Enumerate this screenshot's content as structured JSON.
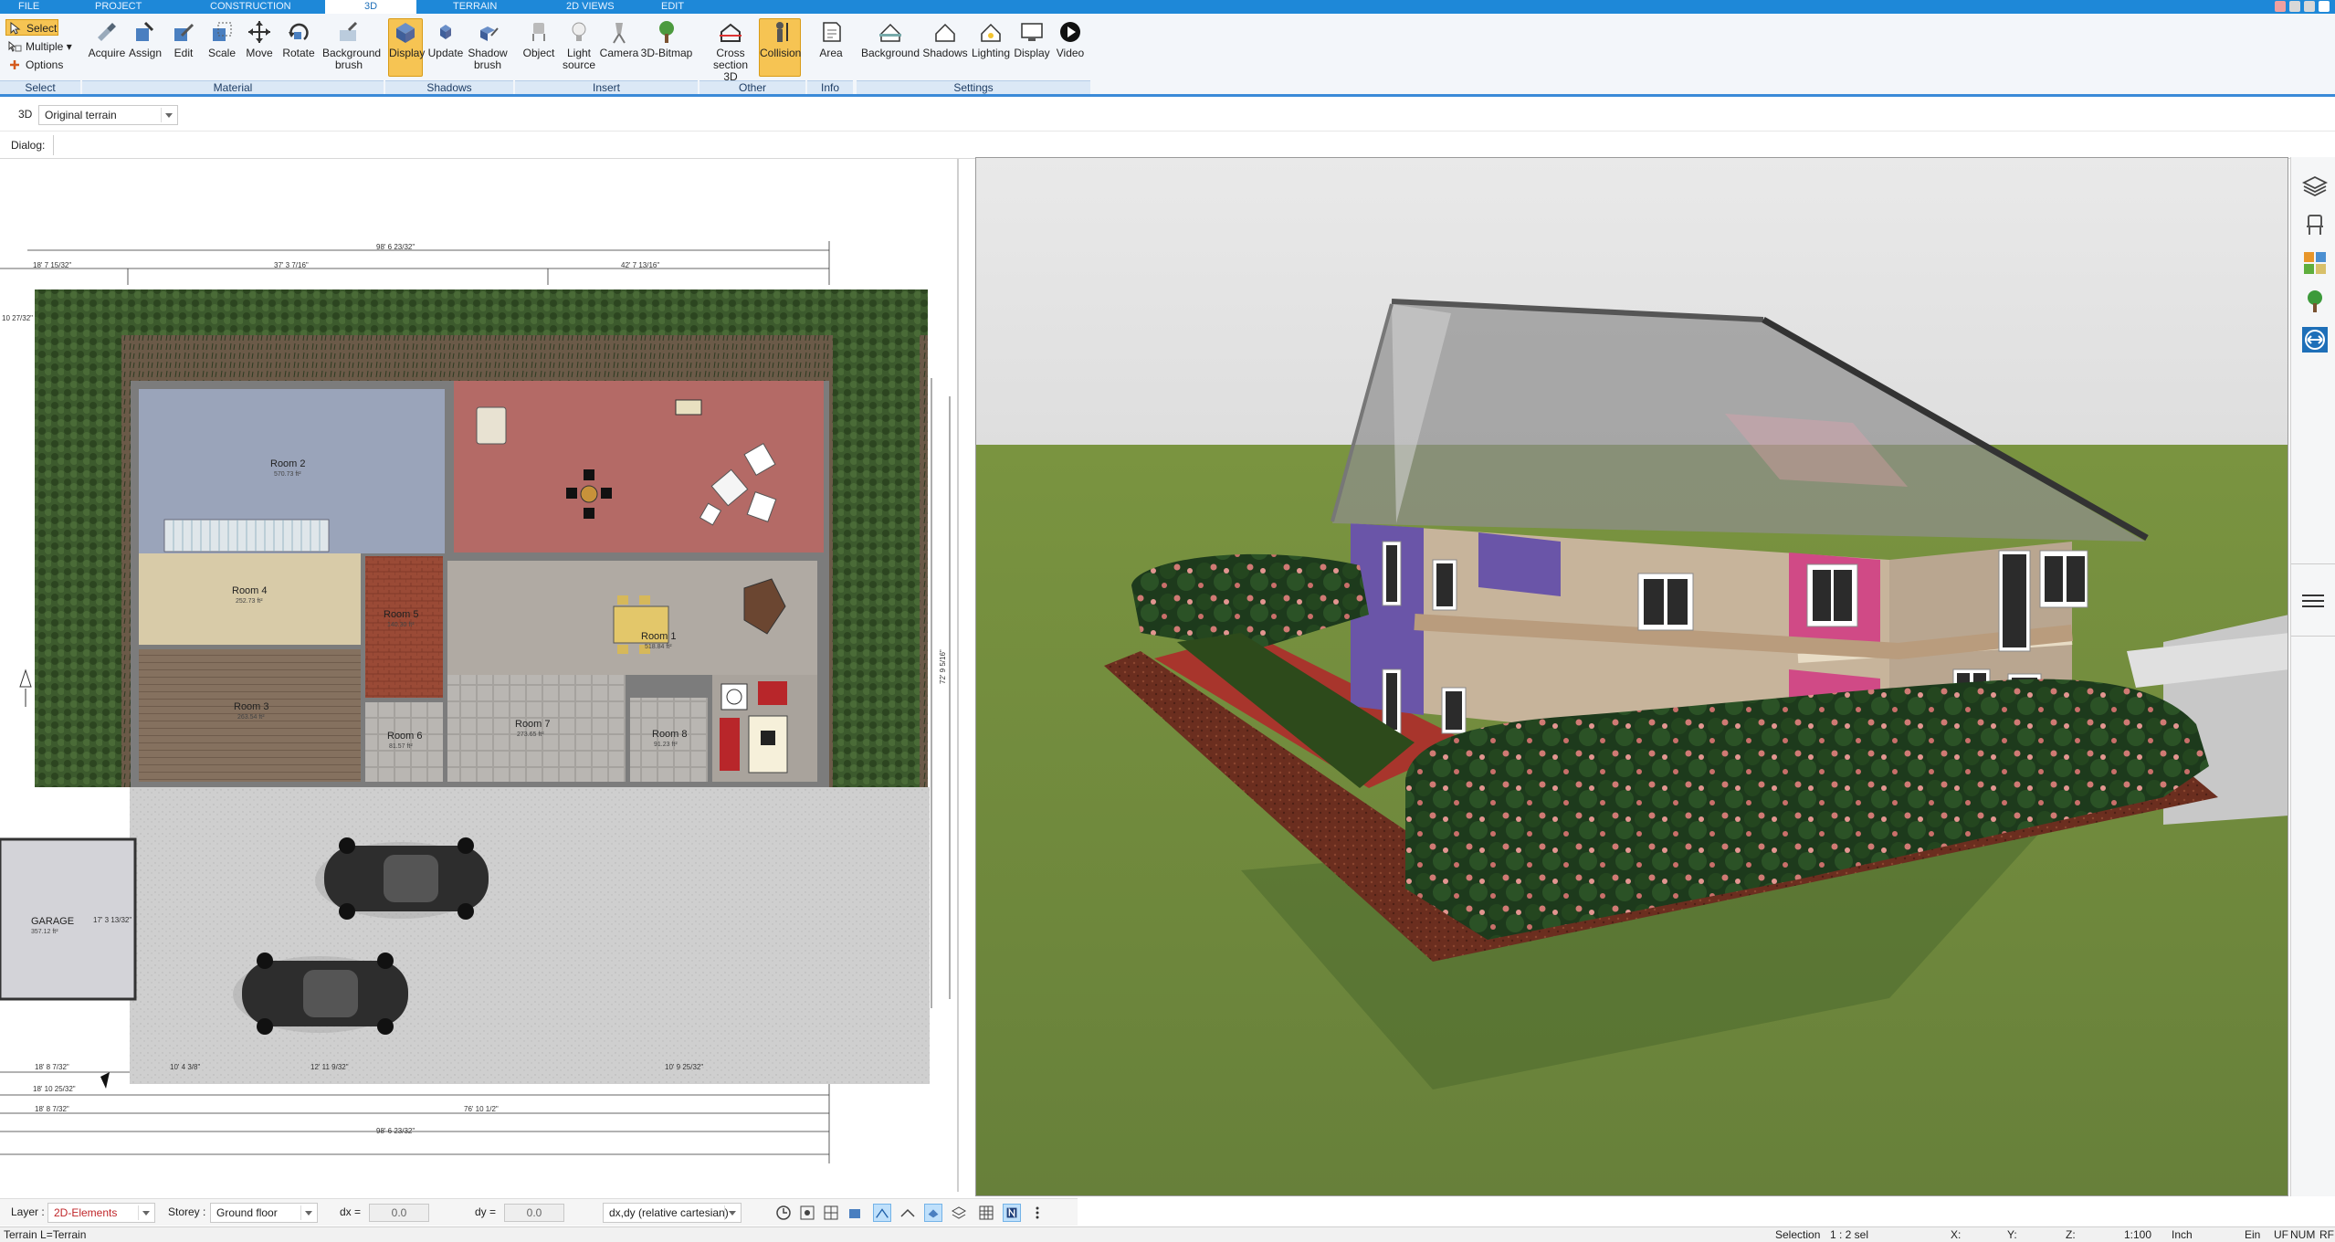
{
  "tabs": [
    {
      "label": "FILE",
      "active": false
    },
    {
      "label": "PROJECT",
      "active": false
    },
    {
      "label": "CONSTRUCTION",
      "active": false
    },
    {
      "label": "3D",
      "active": true
    },
    {
      "label": "TERRAIN",
      "active": false
    },
    {
      "label": "2D VIEWS",
      "active": false
    },
    {
      "label": "EDIT",
      "active": false
    }
  ],
  "ribbon": {
    "select_group": {
      "select": "Select",
      "multiple": "Multiple",
      "options": "Options",
      "label": "Select"
    },
    "material": {
      "label": "Material",
      "acquire": "Acquire",
      "assign": "Assign",
      "edit": "Edit",
      "scale": "Scale",
      "move": "Move",
      "rotate": "Rotate",
      "background_brush": "Background brush"
    },
    "shadows": {
      "label": "Shadows",
      "display": "Display",
      "update": "Update",
      "shadow_brush": "Shadow brush"
    },
    "insert": {
      "label": "Insert",
      "object": "Object",
      "light_source": "Light source",
      "camera": "Camera",
      "bitmap": "3D-Bitmap"
    },
    "other": {
      "label": "Other",
      "cross_section": "Cross section 3D",
      "collision": "Collision"
    },
    "info": {
      "label": "Info",
      "area": "Area"
    },
    "settings": {
      "label": "Settings",
      "background": "Background",
      "shadows": "Shadows",
      "lighting": "Lighting",
      "display": "Display",
      "video": "Video"
    }
  },
  "view_row": {
    "mode": "3D",
    "terrain_select": "Original terrain"
  },
  "dialog_row": {
    "label": "Dialog:"
  },
  "plan": {
    "rooms": [
      {
        "name": "Room 2",
        "area": "570.73 ft²"
      },
      {
        "name": "Room 4",
        "area": "252.73 ft²"
      },
      {
        "name": "Room 5",
        "area": "140.30 ft²"
      },
      {
        "name": "Room 1",
        "area": "518.84 ft²"
      },
      {
        "name": "Room 3",
        "area": "263.54 ft²"
      },
      {
        "name": "Room 6",
        "area": "81.57 ft²"
      },
      {
        "name": "Room 7",
        "area": "273.65 ft²"
      },
      {
        "name": "Room 8",
        "area": "91.23 ft²"
      },
      {
        "name": "GARAGE",
        "area": "357.12 ft²"
      }
    ],
    "dimensions": {
      "top_total": "98' 6 23/32\"",
      "top_left": "18' 7 15/32\"",
      "top_seg1": "37' 3 7/16\"",
      "top_seg2": "42' 7 13/16\"",
      "left_edge": "10 27/32\"",
      "bottom_1": "18' 8 7/32\"",
      "bottom_2": "18' 10 25/32\"",
      "bottom_3": "18' 8 7/32\"",
      "bottom_4": "76' 10 1/2\"",
      "bottom_total": "98' 6 23/32\"",
      "bottom_seg_a": "10' 4 3/8\"",
      "bottom_seg_b": "12' 11 9/32\"",
      "bottom_seg_c": "10' 9 25/32\"",
      "right_1": "72' 9 5/16\"",
      "garage_dim": "17' 3 13/32\""
    }
  },
  "plan_bottom": {
    "layer_label": "Layer :",
    "layer_value": "2D-Elements",
    "storey_label": "Storey :",
    "storey_value": "Ground floor",
    "dx_label": "dx =",
    "dx_value": "0.0",
    "dy_label": "dy =",
    "dy_value": "0.0",
    "coord_mode": "dx,dy (relative cartesian)"
  },
  "statusbar": {
    "left": "Terrain L=Terrain",
    "selection": "Selection",
    "sel_count": "1 : 2 sel",
    "x": "X:",
    "y": "Y:",
    "z": "Z:",
    "scale": "1:100",
    "unit": "Inch",
    "ein": "Ein",
    "uf": "UF",
    "num": "NUM",
    "rf": "RF"
  },
  "colors": {
    "accent": "#1e88d8",
    "active_button": "#f6c453",
    "grass": "#6f8a3c",
    "roof": "#8e8e8e"
  },
  "icons": [
    "select-icon",
    "acquire-icon",
    "assign-icon",
    "edit-icon",
    "scale-icon",
    "move-icon",
    "rotate-icon",
    "background-brush-icon",
    "shadow-display-icon",
    "update-icon",
    "shadow-brush-icon",
    "object-icon",
    "light-source-icon",
    "camera-icon",
    "bitmap-3d-icon",
    "cross-section-icon",
    "collision-icon",
    "area-icon",
    "background-icon",
    "shadows-icon",
    "lighting-icon",
    "display-icon",
    "video-icon",
    "layers-icon",
    "chair-icon",
    "material-palette-icon",
    "tree-icon",
    "navigate-icon"
  ]
}
